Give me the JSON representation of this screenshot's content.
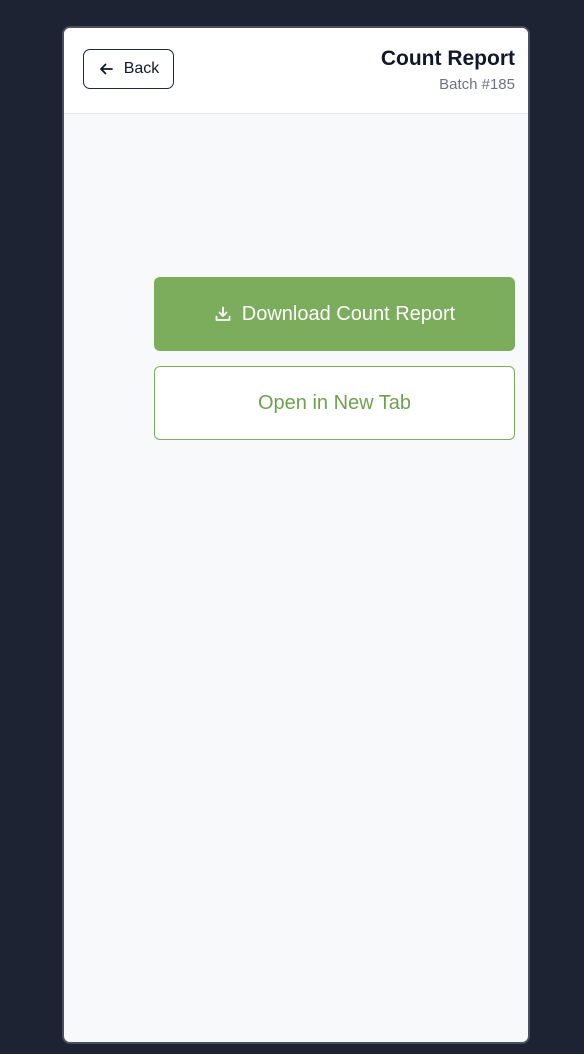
{
  "header": {
    "back_label": "Back",
    "title": "Count Report",
    "subtitle": "Batch #185"
  },
  "actions": {
    "download_label": "Download Count Report",
    "open_new_tab_label": "Open in New Tab"
  },
  "icons": {
    "back": "arrow-left-icon",
    "download": "download-icon"
  },
  "colors": {
    "accent": "#7bad5c",
    "background": "#1e2333",
    "panel": "#f8f9fb"
  }
}
